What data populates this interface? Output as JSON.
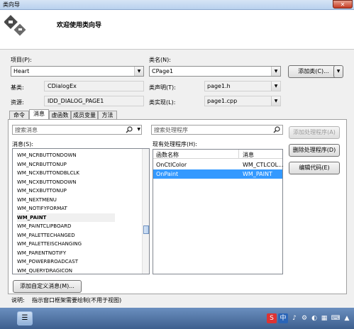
{
  "window": {
    "title": "类向导",
    "close_glyph": "✕"
  },
  "header": {
    "welcome": "欢迎使用类向导"
  },
  "project": {
    "label": "项目(P):",
    "value": "Heart"
  },
  "class_name": {
    "label": "类名(N):",
    "value": "CPage1"
  },
  "add_class_button": {
    "label": "添加类(C)...",
    "dropdown_glyph": "▼"
  },
  "base_class": {
    "label": "基类:",
    "value": "CDialogEx"
  },
  "class_decl": {
    "label": "类声明(T):",
    "value": "page1.h"
  },
  "resource": {
    "label": "资源:",
    "value": "IDD_DIALOG_PAGE1"
  },
  "class_impl": {
    "label": "类实现(L):",
    "value": "page1.cpp"
  },
  "tabs": [
    {
      "label": "命令"
    },
    {
      "label": "消息"
    },
    {
      "label": "虚函数"
    },
    {
      "label": "成员变量"
    },
    {
      "label": "方法"
    }
  ],
  "messages": {
    "search_placeholder": "搜索消息",
    "label": "消息(S):",
    "items": [
      "WM_NCRBUTTONDOWN",
      "WM_NCRBUTTONUP",
      "WM_NCXBUTTONDBLCLK",
      "WM_NCXBUTTONDOWN",
      "WM_NCXBUTTONUP",
      "WM_NEXTMENU",
      "WM_NOTIFYFORMAT",
      "WM_PAINT",
      "WM_PAINTCLIPBOARD",
      "WM_PALETTECHANGED",
      "WM_PALETTEISCHANGING",
      "WM_PARENTNOTIFY",
      "WM_POWERBROADCAST",
      "WM_QUERYDRAGICON"
    ],
    "selected_index": 7
  },
  "handlers": {
    "search_placeholder": "搜索处理程序",
    "label": "现有处理程序(H):",
    "columns": [
      "函数名称",
      "消息"
    ],
    "rows": [
      [
        "OnCtlColor",
        "WM_CTLCOL..."
      ],
      [
        "OnPaint",
        "WM_PAINT"
      ]
    ],
    "selected_index": 1
  },
  "buttons": {
    "add_handler": "添加处理程序(A)",
    "delete_handler": "删除处理程序(D)",
    "edit_code": "编辑代码(E)",
    "add_custom_message": "添加自定义消息(M)..."
  },
  "description": {
    "label": "说明:",
    "text": "指示窗口框架需要绘制(不用于视图)"
  },
  "taskbar": {
    "tray_items": [
      "S",
      "中",
      "♪",
      "⚙",
      "◐",
      "▦",
      "⌨",
      "▲"
    ]
  },
  "colors": {
    "selection": "#3399ff",
    "disabled_text": "#9a9a9a"
  }
}
